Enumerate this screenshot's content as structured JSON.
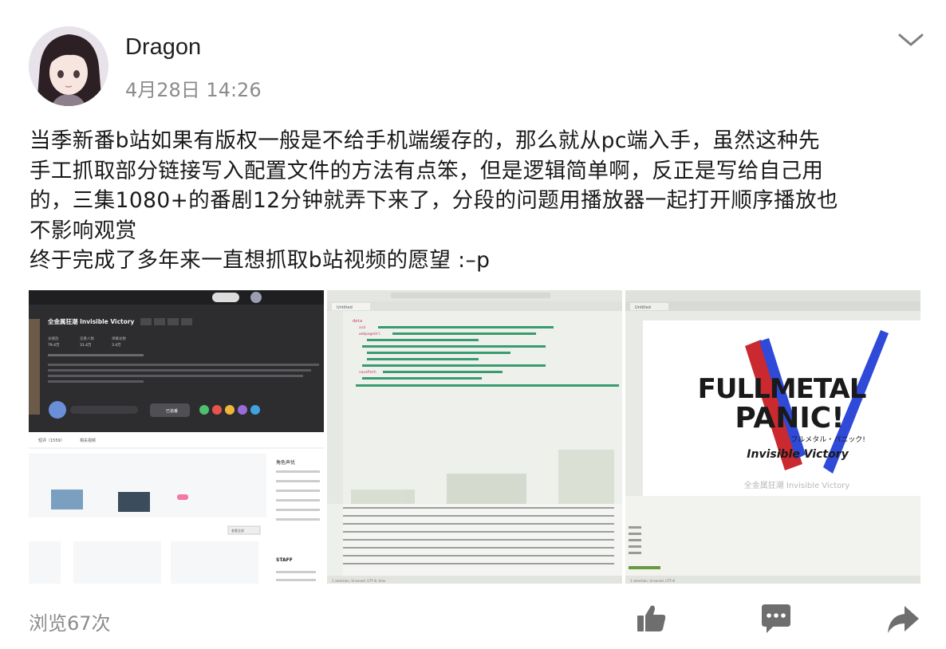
{
  "post": {
    "author": "Dragon",
    "timestamp": "4月28日 14:26",
    "text_lines": [
      "当季新番b站如果有版权一般是不给手机端缓存的，那么就从pc端入手，虽然这种先",
      "手工抓取部分链接写入配置文件的方法有点笨，但是逻辑简单啊，反正是写给自己用",
      "的，三集1080+的番剧12分钟就弄下来了，分段的问题用播放器一起打开顺序播放也",
      "不影响观赏",
      "终于完成了多年来一直想抓取b站视频的愿望 :–p"
    ],
    "views": "浏览67次"
  },
  "photos": {
    "photo1": {
      "title": "全金属狂潮 Invisible Victory",
      "tags": [
        "热血",
        "战斗",
        "科幻",
        "机战"
      ],
      "stats_labels": [
        "总播放",
        "追番人数",
        "弹幕总数"
      ],
      "stats_values": [
        "79.4万",
        "31.4万",
        "3.4万"
      ],
      "follow_label": "已追番",
      "tabs": [
        "短评（1559）",
        "相关视频"
      ],
      "sidebar_title": "角色声优",
      "staff_title": "STAFF",
      "more_label": "查看全部"
    },
    "photo2": {
      "tab_label": "Untitled",
      "json_keys": [
        "data",
        "aid",
        "webpageUrl",
        "savePath"
      ],
      "footer": "1 selection, Unsaved, UTF-8, Unix"
    },
    "photo3": {
      "tab_label": "Untitled",
      "logo_line1": "FULLMETAL",
      "logo_line2": "PANIC!",
      "logo_katakana": "フルメタル・パニック!",
      "logo_subtitle": "Invisible Victory",
      "logo_caption": "全金属狂潮 Invisible Victory",
      "footer": "1 selection, Unsaved, UTF-8"
    }
  },
  "colors": {
    "timestamp": "#8c8c8c",
    "icon": "#6e6e6e",
    "red": "#c9292f",
    "blue": "#2f49d8"
  },
  "icons": [
    "chevron-down-icon",
    "thumbs-up-icon",
    "comment-icon",
    "share-arrow-icon"
  ]
}
